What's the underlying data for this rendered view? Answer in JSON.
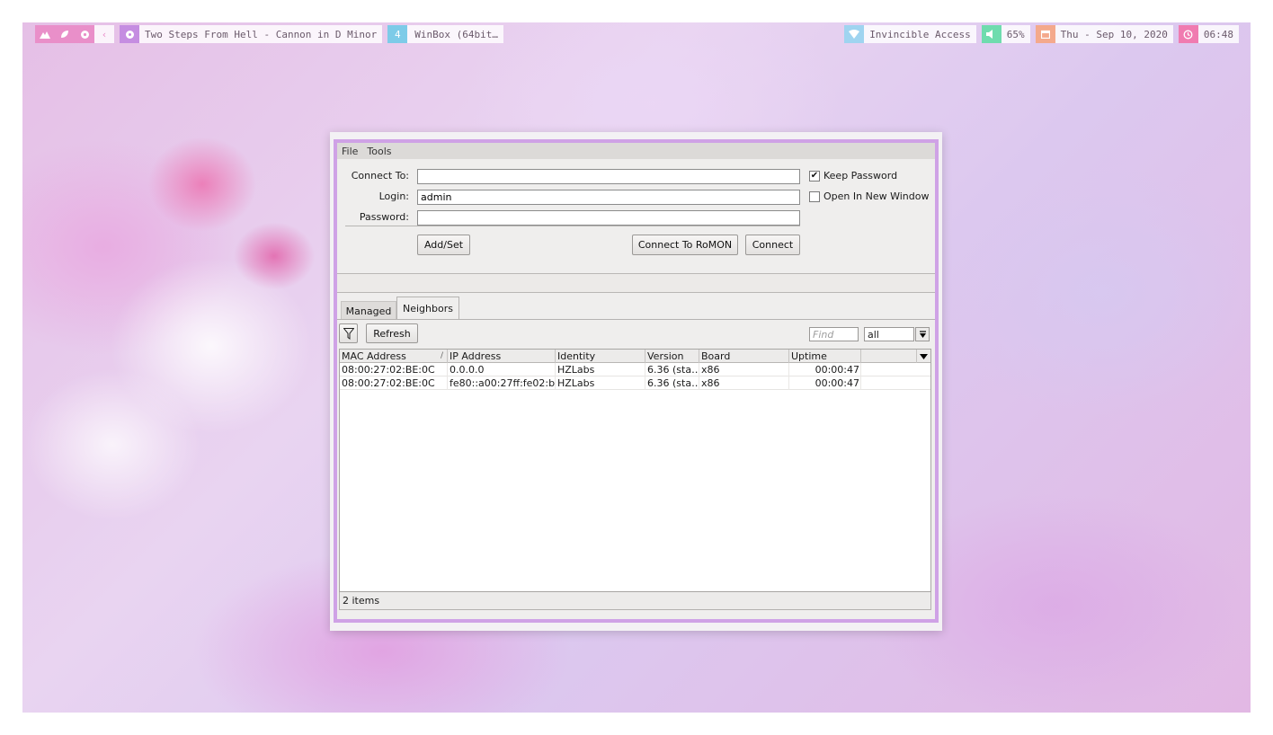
{
  "topbar": {
    "left": {
      "workspace_icons": [
        "mountain-icon",
        "leaf-icon",
        "flower-icon",
        "chevron-left-icon"
      ],
      "music_icon": "music-disc-icon",
      "music_title": "Two Steps From Hell - Cannon in D Minor",
      "workspace_number": "4",
      "window_title": "WinBox (64bit…"
    },
    "right": {
      "wifi_label": "Invincible Access",
      "volume_label": "65%",
      "date_label": "Thu - Sep 10, 2020",
      "time_label": "06:48"
    },
    "colors": {
      "pink": "#e98fc9",
      "purple": "#c58de1",
      "blue": "#7dcbe8",
      "sky": "#9fd4f0",
      "green": "#6fdcae",
      "orange": "#f4a98c",
      "red": "#f07bb0"
    }
  },
  "winbox": {
    "menu": [
      "File",
      "Tools"
    ],
    "connect_to_label": "Connect To:",
    "connect_to_value": "",
    "login_label": "Login:",
    "login_value": "admin",
    "password_label": "Password:",
    "password_value": "",
    "keep_password_label": "Keep Password",
    "keep_password_checked": true,
    "keep_password_mark": "✔",
    "open_new_window_label": "Open In New Window",
    "open_new_window_checked": false,
    "add_set_label": "Add/Set",
    "connect_romon_label": "Connect To RoMON",
    "connect_label": "Connect",
    "tabs": [
      "Managed",
      "Neighbors"
    ],
    "active_tab": "Neighbors",
    "refresh_label": "Refresh",
    "find_placeholder": "Find",
    "filter_value": "all",
    "table": {
      "columns": [
        "MAC Address",
        "IP Address",
        "Identity",
        "Version",
        "Board",
        "Uptime"
      ],
      "sort_mark": "/",
      "rows": [
        [
          "08:00:27:02:BE:0C",
          "0.0.0.0",
          "HZLabs",
          "6.36 (sta…",
          "x86",
          "00:00:47"
        ],
        [
          "08:00:27:02:BE:0C",
          "fe80::a00:27ff:fe02:b…",
          "HZLabs",
          "6.36 (sta…",
          "x86",
          "00:00:47"
        ]
      ]
    },
    "items_count": "2 items"
  }
}
